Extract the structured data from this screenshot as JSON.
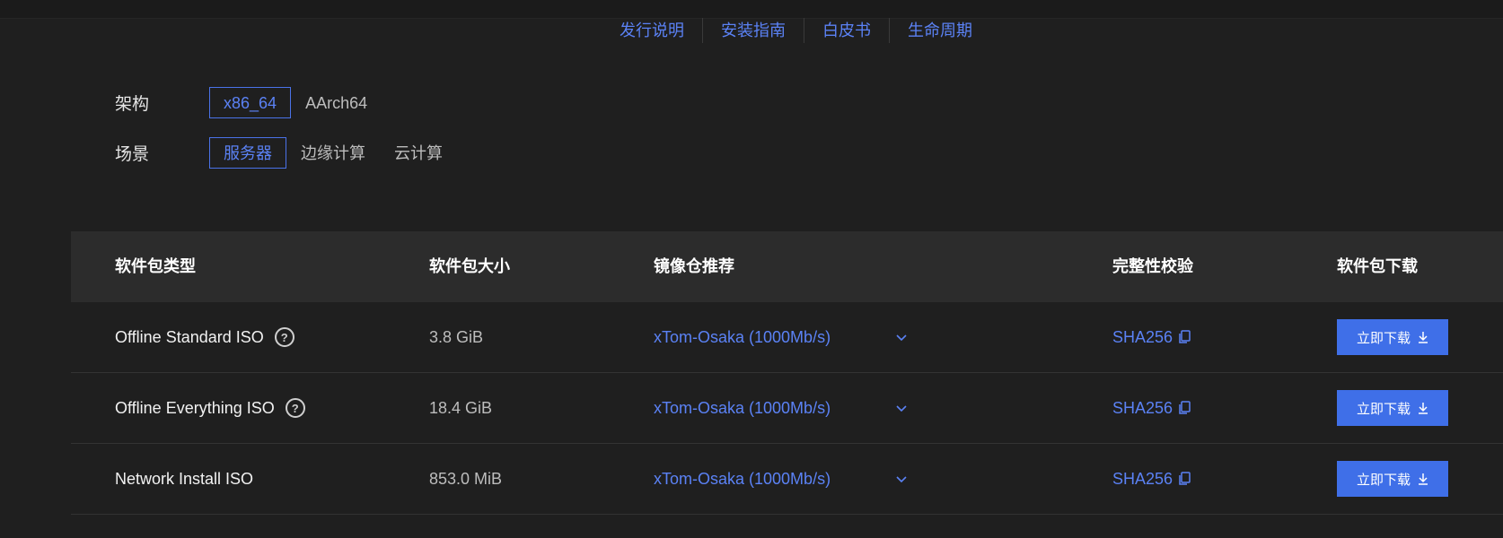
{
  "doc_links": [
    "发行说明",
    "安装指南",
    "白皮书",
    "生命周期"
  ],
  "filters": {
    "arch": {
      "label": "架构",
      "options": [
        "x86_64",
        "AArch64"
      ],
      "selected": "x86_64"
    },
    "scenario": {
      "label": "场景",
      "options": [
        "服务器",
        "边缘计算",
        "云计算"
      ],
      "selected": "服务器"
    }
  },
  "table": {
    "headers": {
      "type": "软件包类型",
      "size": "软件包大小",
      "mirror": "镜像仓推荐",
      "hash": "完整性校验",
      "download": "软件包下载"
    },
    "rows": [
      {
        "type": "Offline Standard ISO",
        "has_help": true,
        "size": "3.8 GiB",
        "mirror": "xTom-Osaka (1000Mb/s)",
        "hash": "SHA256",
        "download": "立即下载"
      },
      {
        "type": "Offline Everything ISO",
        "has_help": true,
        "size": "18.4 GiB",
        "mirror": "xTom-Osaka (1000Mb/s)",
        "hash": "SHA256",
        "download": "立即下载"
      },
      {
        "type": "Network Install ISO",
        "has_help": false,
        "size": "853.0 MiB",
        "mirror": "xTom-Osaka (1000Mb/s)",
        "hash": "SHA256",
        "download": "立即下载"
      }
    ]
  },
  "colors": {
    "background": "#1f1f1f",
    "accent": "#3f6fe8",
    "link": "#5b82f5",
    "header_bg": "#2c2c2c"
  }
}
